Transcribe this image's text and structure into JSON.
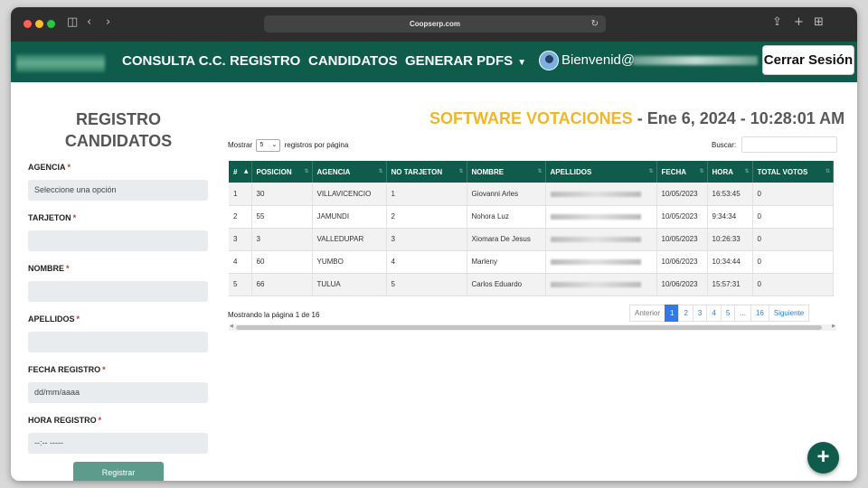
{
  "browser": {
    "url": "Coopserp.com"
  },
  "nav": {
    "links": [
      "CONSULTA C.C.",
      "REGISTRO",
      "CANDIDATOS",
      "GENERAR PDFS"
    ],
    "welcome": "Bienvenid@",
    "logout": "Cerrar Sesión"
  },
  "form": {
    "title": "REGISTRO CANDIDATOS",
    "agencia_label": "AGENCIA",
    "agencia_value": "Seleccione una opción",
    "tarjeton_label": "TARJETON",
    "nombre_label": "NOMBRE",
    "apellidos_label": "APELLIDOS",
    "fecha_label": "FECHA REGISTRO",
    "fecha_value": "dd/mm/aaaa",
    "hora_label": "HORA REGISTRO",
    "hora_value": "--:-- -----",
    "required_mark": "*",
    "submit": "Registrar"
  },
  "header": {
    "brand": "SOFTWARE VOTACIONES",
    "datetime": "- Ene 6, 2024 - 10:28:01 AM"
  },
  "table_controls": {
    "show_prefix": "Mostrar",
    "page_size": "5",
    "show_suffix": "registros por página",
    "search_label": "Buscar:"
  },
  "table": {
    "columns": [
      "#",
      "POSICION",
      "AGENCIA",
      "NO TARJETON",
      "NOMBRE",
      "APELLIDOS",
      "FECHA",
      "HORA",
      "TOTAL VOTOS"
    ],
    "rows": [
      [
        "1",
        "30",
        "VILLAVICENCIO",
        "1",
        "Giovanni Arles",
        "",
        "10/05/2023",
        "16:53:45",
        "0"
      ],
      [
        "2",
        "55",
        "JAMUNDI",
        "2",
        "Nohora Luz",
        "",
        "10/05/2023",
        "9:34:34",
        "0"
      ],
      [
        "3",
        "3",
        "VALLEDUPAR",
        "3",
        "Xiomara De Jesus",
        "",
        "10/05/2023",
        "10:26:33",
        "0"
      ],
      [
        "4",
        "60",
        "YUMBO",
        "4",
        "Marleny",
        "",
        "10/06/2023",
        "10:34:44",
        "0"
      ],
      [
        "5",
        "66",
        "TULUA",
        "5",
        "Carlos Eduardo",
        "",
        "10/06/2023",
        "15:57:31",
        "0"
      ]
    ]
  },
  "pagination": {
    "info": "Mostrando la página 1 de 16",
    "prev": "Anterior",
    "pages": [
      "1",
      "2",
      "3",
      "4",
      "5",
      "...",
      "16"
    ],
    "next": "Siguiente",
    "active_page": "1"
  },
  "fab": "+",
  "colors": {
    "primary": "#0f5b4c",
    "brand_text": "#f0b62a",
    "pager_active": "#2f7ae5"
  }
}
